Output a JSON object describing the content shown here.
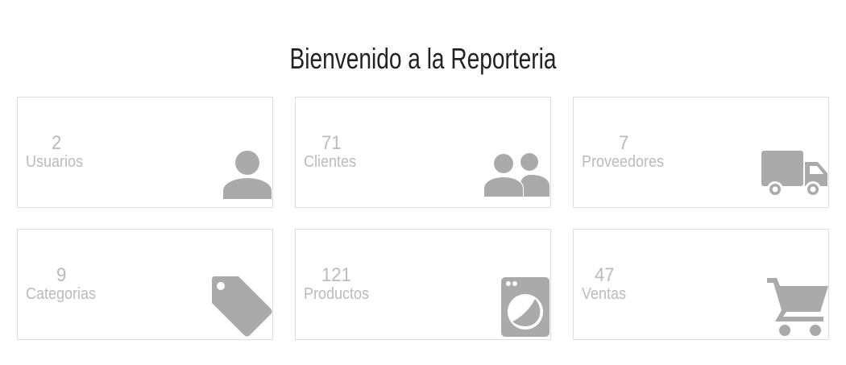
{
  "header": {
    "title": "Bienvenido a la Reporteria"
  },
  "cards": [
    {
      "count": "2",
      "label": "Usuarios",
      "icon": "user-icon"
    },
    {
      "count": "71",
      "label": "Clientes",
      "icon": "group-icon"
    },
    {
      "count": "7",
      "label": "Proveedores",
      "icon": "truck-icon"
    },
    {
      "count": "9",
      "label": "Categorias",
      "icon": "tag-icon"
    },
    {
      "count": "121",
      "label": "Productos",
      "icon": "washing-machine-icon"
    },
    {
      "count": "47",
      "label": "Ventas",
      "icon": "shopping-cart-icon"
    }
  ],
  "colors": {
    "icon": "#aaaaaa",
    "text": "#bbbbbb",
    "border": "#dedede",
    "title": "#222222"
  }
}
